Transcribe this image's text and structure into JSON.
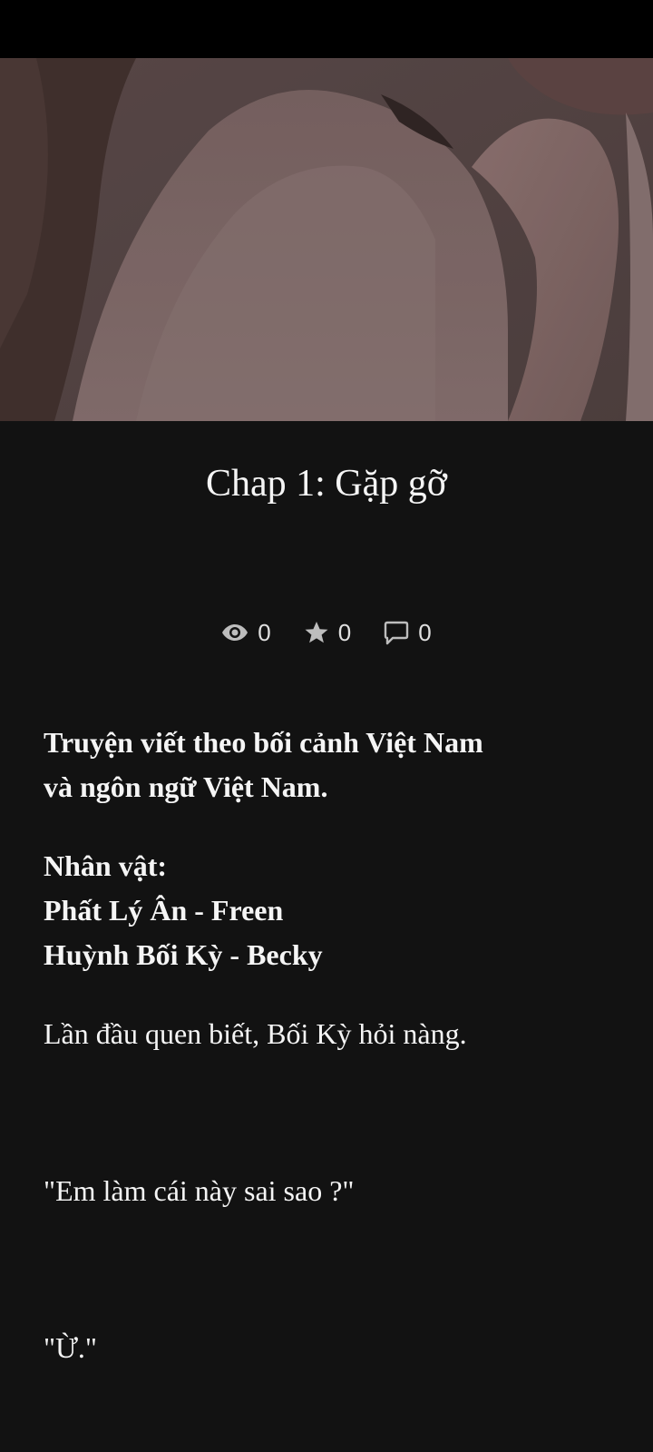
{
  "chapter": {
    "title": "Chap 1: Gặp gỡ"
  },
  "stats": {
    "views": "0",
    "votes": "0",
    "comments": "0"
  },
  "icons": {
    "views": "eye-icon",
    "votes": "star-icon",
    "comments": "comment-icon"
  },
  "colors": {
    "background": "#121212",
    "status_bar": "#000000",
    "text": "#f5f5f5",
    "stat_text": "#e0e0e0"
  },
  "content": {
    "intro": [
      "Truyện viết theo bối cảnh Việt Nam",
      "và ngôn ngữ Việt Nam."
    ],
    "characters_heading": "Nhân vật:",
    "character_1": "Phất Lý Ân - Freen",
    "character_2": "Huỳnh Bối Kỳ - Becky",
    "line_1": "Lần đầu quen biết, Bối Kỳ hỏi nàng.",
    "line_2": "\"Em làm cái này sai sao ?\"",
    "line_3": "\"Ừ.\""
  }
}
